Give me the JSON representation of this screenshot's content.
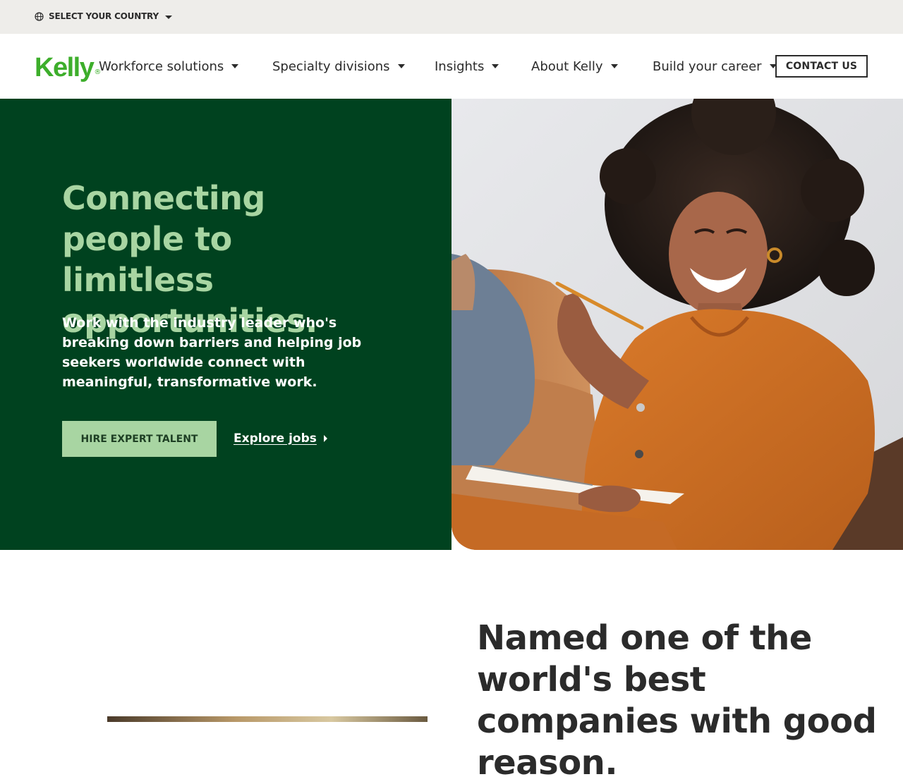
{
  "utility_bar": {
    "country_label": "SELECT YOUR COUNTRY",
    "globe_icon": "globe-icon"
  },
  "header": {
    "logo_text": "Kelly",
    "logo_mark": "®",
    "nav": [
      {
        "label": "Workforce solutions"
      },
      {
        "label": "Specialty divisions"
      },
      {
        "label": "Insights"
      },
      {
        "label": "About Kelly"
      },
      {
        "label": "Build your career"
      }
    ],
    "contact_label": "CONTACT US"
  },
  "hero": {
    "title": "Connecting people to limitless opportunities.",
    "description": "Work with the industry leader who's breaking down barriers and helping job seekers worldwide connect with meaningful, transformative work.",
    "primary_button": "HIRE EXPERT TALENT",
    "secondary_link": "Explore jobs",
    "colors": {
      "background": "#00421f",
      "title": "#a8d5a2",
      "button": "#a8d5a2"
    }
  },
  "award": {
    "heading": "Named one of the world's best companies with good reason."
  },
  "brand": {
    "logo_color": "#3dae2b",
    "text_color": "#2b2b2b"
  }
}
